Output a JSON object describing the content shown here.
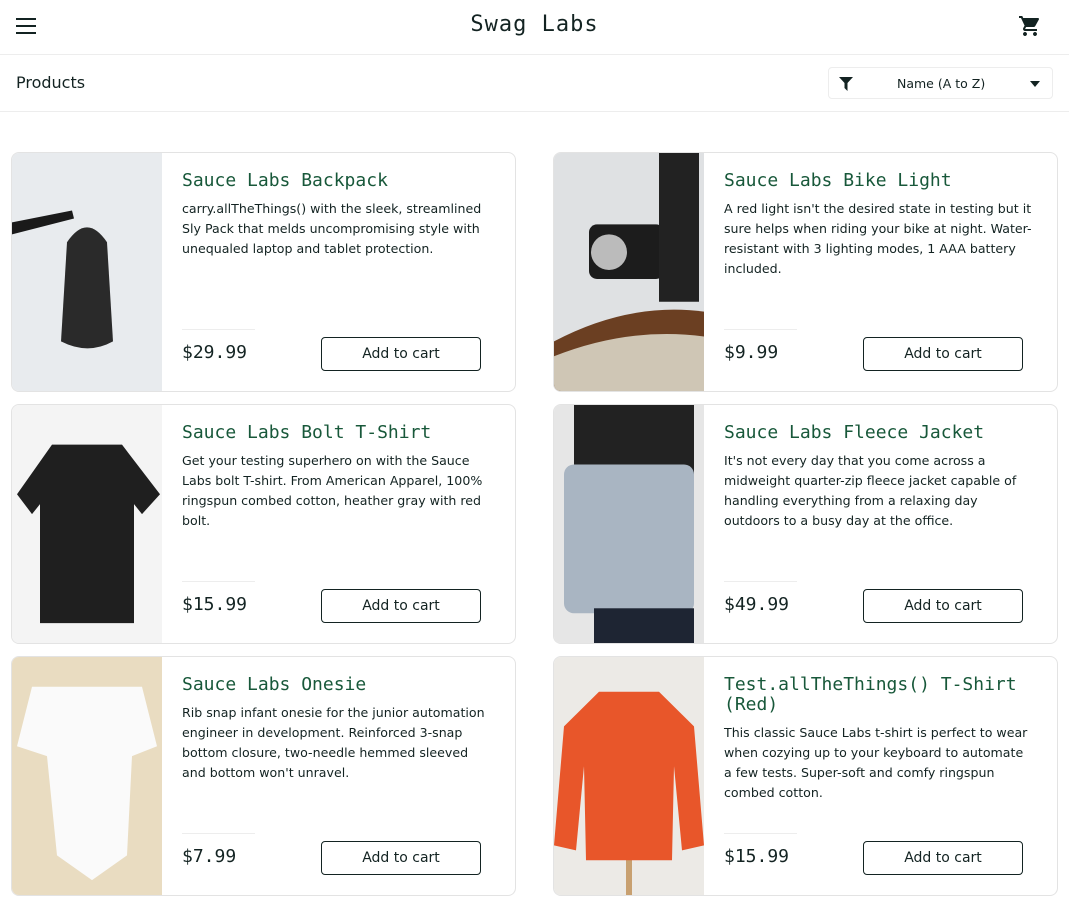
{
  "header": {
    "title": "Swag Labs",
    "menu_icon": "hamburger-icon",
    "cart_icon": "shopping-cart-icon"
  },
  "subheader": {
    "title": "Products",
    "sort": {
      "icon": "filter-icon",
      "selected": "Name (A to Z)"
    }
  },
  "colors": {
    "title_green": "#18583a",
    "text": "#132322",
    "border": "#ededed"
  },
  "products": [
    {
      "name": "Sauce Labs Backpack",
      "desc": "carry.allTheThings() with the sleek, streamlined Sly Pack that melds uncompromising style with unequaled laptop and tablet protection.",
      "price": "$29.99",
      "button": "Add to cart"
    },
    {
      "name": "Sauce Labs Bike Light",
      "desc": "A red light isn't the desired state in testing but it sure helps when riding your bike at night. Water-resistant with 3 lighting modes, 1 AAA battery included.",
      "price": "$9.99",
      "button": "Add to cart"
    },
    {
      "name": "Sauce Labs Bolt T-Shirt",
      "desc": "Get your testing superhero on with the Sauce Labs bolt T-shirt. From American Apparel, 100% ringspun combed cotton, heather gray with red bolt.",
      "price": "$15.99",
      "button": "Add to cart"
    },
    {
      "name": "Sauce Labs Fleece Jacket",
      "desc": "It's not every day that you come across a midweight quarter-zip fleece jacket capable of handling everything from a relaxing day outdoors to a busy day at the office.",
      "price": "$49.99",
      "button": "Add to cart"
    },
    {
      "name": "Sauce Labs Onesie",
      "desc": "Rib snap infant onesie for the junior automation engineer in development. Reinforced 3-snap bottom closure, two-needle hemmed sleeved and bottom won't unravel.",
      "price": "$7.99",
      "button": "Add to cart"
    },
    {
      "name": "Test.allTheThings() T-Shirt (Red)",
      "desc": "This classic Sauce Labs t-shirt is perfect to wear when cozying up to your keyboard to automate a few tests. Super-soft and comfy ringspun combed cotton.",
      "price": "$15.99",
      "button": "Add to cart"
    }
  ]
}
